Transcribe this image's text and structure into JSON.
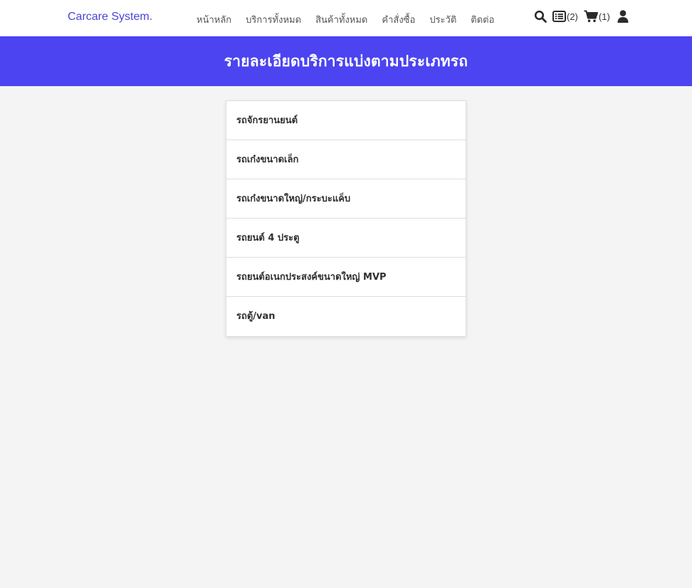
{
  "navbar": {
    "brand": "Carcare System.",
    "links": [
      "หน้าหลัก",
      "บริการทั้งหมด",
      "สินค้าทั้งหมด",
      "คำสั่งซื้อ",
      "ประวัติ",
      "ติดต่อ"
    ],
    "icons": {
      "search": "search-icon",
      "orders": "list-icon",
      "cart": "cart-icon",
      "user": "user-icon"
    },
    "orders_count": "(2)",
    "cart_count": "(1)"
  },
  "banner": {
    "title": "รายละเอียดบริการแบ่งตามประเภทรถ",
    "color": "#4b44f0"
  },
  "vehicle_types": [
    "รถจักรยานยนต์",
    "รถเก๋งขนาดเล็ก",
    "รถเก๋งขนาดใหญ่/กระบะแค็บ",
    "รถยนต์ 4 ประตู",
    "รถยนต์อเนกประสงค์ขนาดใหญ่ MVP",
    "รถตู้/van"
  ],
  "colors": {
    "brand": "#4a45d6",
    "background": "#f4f4f4"
  }
}
